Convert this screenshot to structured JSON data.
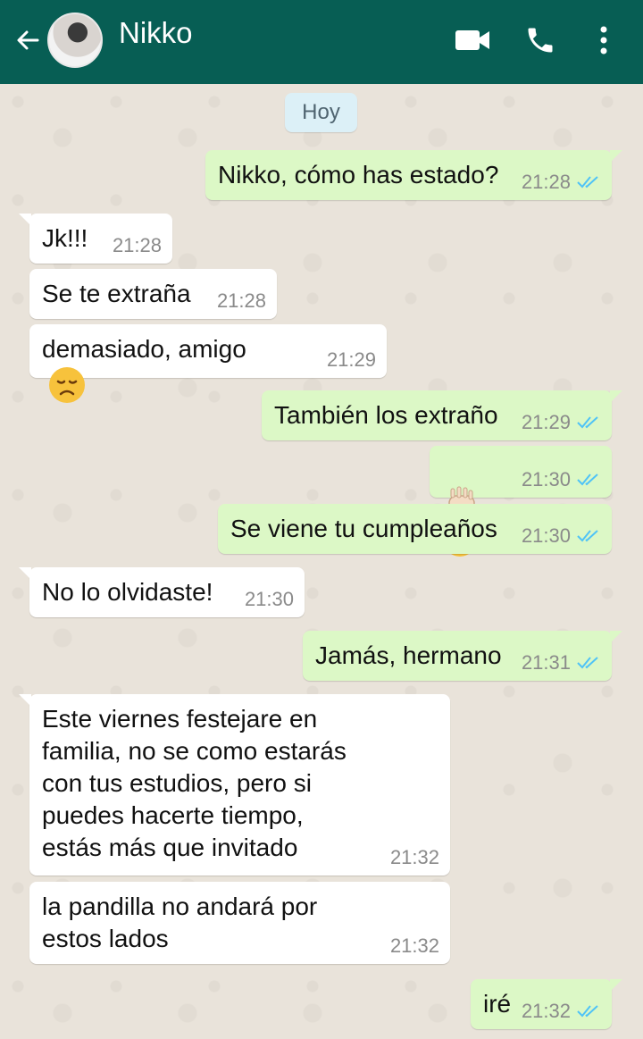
{
  "header": {
    "contact_name": "Nikko",
    "back_icon": "arrow-left-icon",
    "avatar": "contact-avatar",
    "video_icon": "video-call-icon",
    "call_icon": "phone-icon",
    "menu_icon": "more-vertical-icon",
    "bg_color": "#075e54"
  },
  "chat": {
    "date_label": "Hoy",
    "messages": [
      {
        "dir": "out",
        "text": "Nikko, cómo has estado?",
        "time": "21:28"
      },
      {
        "dir": "in",
        "text": "Jk!!!",
        "time": "21:28"
      },
      {
        "dir": "in",
        "text": "Se te extraña",
        "time": "21:28"
      },
      {
        "dir": "in",
        "text": "demasiado, amigo",
        "emoji": "disappointed-face",
        "time": "21:29"
      },
      {
        "dir": "out",
        "text": "También los extraño",
        "time": "21:29"
      },
      {
        "dir": "out",
        "emoji": [
          "raised-fist",
          "pleading-face"
        ],
        "time": "21:30"
      },
      {
        "dir": "out",
        "text": "Se viene tu cumpleaños",
        "time": "21:30"
      },
      {
        "dir": "in",
        "text": "No lo olvidaste!",
        "time": "21:30"
      },
      {
        "dir": "out",
        "text": "Jamás, hermano",
        "time": "21:31"
      },
      {
        "dir": "in",
        "text": "Este viernes festejare en\nfamilia, no se como estarás\ncon tus estudios, pero si\npuedes hacerte tiempo,\nestás más que invitado",
        "time": "21:32"
      },
      {
        "dir": "in",
        "text": "la pandilla no andará por\nestos lados",
        "time": "21:32"
      },
      {
        "dir": "out",
        "text": "iré",
        "time": "21:32"
      }
    ]
  },
  "colors": {
    "incoming": "#ffffff",
    "outgoing": "#dcf8c6",
    "read_ticks": "#4fc3f7"
  }
}
